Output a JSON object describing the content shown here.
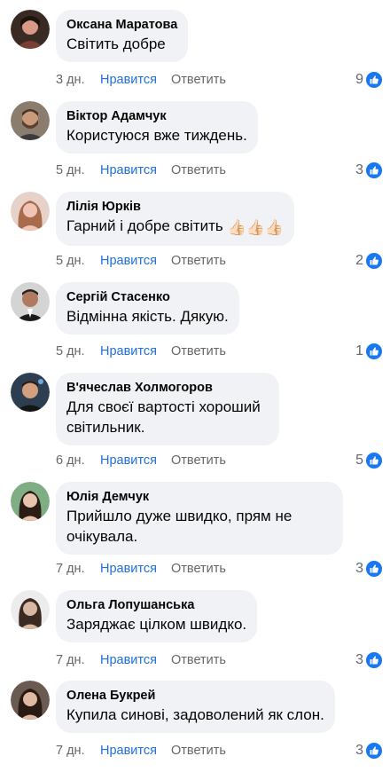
{
  "comments": [
    {
      "author": "Оксана Маратова",
      "text": "Світить добре",
      "time": "3 дн.",
      "like_label": "Нравится",
      "reply_label": "Ответить",
      "reaction_count": "9",
      "avatar_bg": "#3a2a24",
      "avatar_fg": "#d89a86"
    },
    {
      "author": "Віктор Адамчук",
      "text": "Користуюся  вже тиждень.",
      "time": "5 дн.",
      "like_label": "Нравится",
      "reply_label": "Ответить",
      "reaction_count": "3",
      "avatar_bg": "#8a7d6e",
      "avatar_fg": "#c99a7c"
    },
    {
      "author": "Лілія Юрків",
      "text": "Гарний і добре світить",
      "emoji": "👍🏻👍🏻👍🏻",
      "time": "5 дн.",
      "like_label": "Нравится",
      "reply_label": "Ответить",
      "reaction_count": "2",
      "avatar_bg": "#c8a296",
      "avatar_fg": "#f0c5b6"
    },
    {
      "author": "Сергій Стасенко",
      "text": "Відмінна якість. Дякую.",
      "time": "5 дн.",
      "like_label": "Нравится",
      "reply_label": "Ответить",
      "reaction_count": "1",
      "avatar_bg": "#c9c9c9",
      "avatar_fg": "#b07a60"
    },
    {
      "author": "В'ячеслав Холмогоров",
      "text": "Для своєї вартості хороший світильник.",
      "time": "6 дн.",
      "like_label": "Нравится",
      "reply_label": "Ответить",
      "reaction_count": "5",
      "avatar_bg": "#2c3e50",
      "avatar_fg": "#d3a07f"
    },
    {
      "author": "Юлія Демчук",
      "text": "Прийшло дуже швидко, прям не очікувала.",
      "time": "7 дн.",
      "like_label": "Нравится",
      "reply_label": "Ответить",
      "reaction_count": "3",
      "avatar_bg": "#7fae84",
      "avatar_fg": "#e8c3ad"
    },
    {
      "author": "Ольга Лопушанська",
      "text": "Заряджає цілком швидко.",
      "time": "7 дн.",
      "like_label": "Нравится",
      "reply_label": "Ответить",
      "reaction_count": "3",
      "avatar_bg": "#e3e3e3",
      "avatar_fg": "#b9a08e"
    },
    {
      "author": "Олена Букрей",
      "text": "Купила синові, задоволений як слон.",
      "time": "7 дн.",
      "like_label": "Нравится",
      "reply_label": "Ответить",
      "reaction_count": "3",
      "avatar_bg": "#5a4a44",
      "avatar_fg": "#e0b9a4"
    }
  ],
  "colors": {
    "like_blue": "#216fdb",
    "bubble": "#f0f2f5",
    "muted": "#65676b",
    "reaction_blue": "#1877f2"
  },
  "icons": {
    "reaction": "thumbs-up-icon"
  }
}
